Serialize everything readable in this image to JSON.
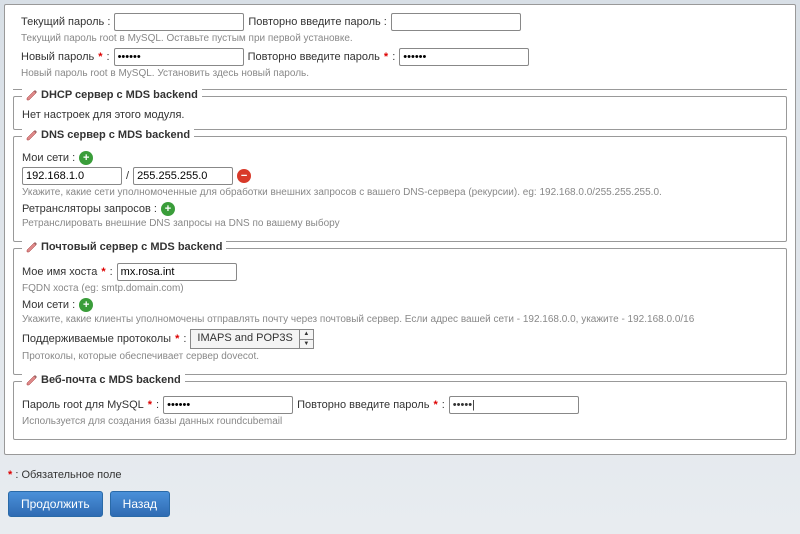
{
  "top": {
    "cur_pw_label": "Текущий пароль :",
    "cur_pw_value": "",
    "repeat_pw_label": "Повторно введите пароль :",
    "repeat_pw_value": "",
    "hint1": "Текущий пароль root в MySQL. Оставьте пустым при первой установке.",
    "new_pw_label": "Новый пароль",
    "new_pw_value": "••••••",
    "repeat2_label": "Повторно введите пароль",
    "repeat2_value": "••••••",
    "hint2": "Новый пароль root в MySQL. Установить здесь новый пароль.",
    "colon": " :"
  },
  "dhcp": {
    "title": "DHCP сервер с MDS backend",
    "empty": "Нет настроек для этого модуля."
  },
  "dns": {
    "title": "DNS сервер с MDS backend",
    "networks_label": "Мои сети :",
    "ip": "192.168.1.0",
    "slash": "/",
    "mask": "255.255.255.0",
    "hint1": "Укажите, какие сети уполномоченные для обработки внешних запросов с вашего DNS-сервера (рекурсии). eg: 192.168.0.0/255.255.255.0.",
    "relays_label": "Ретрансляторы запросов :",
    "hint2": "Ретранслировать внешние DNS запросы на DNS по вашему выбору"
  },
  "mail": {
    "title": "Почтовый сервер с MDS backend",
    "host_label": "Мое имя хоста",
    "host_value": "mx.rosa.int",
    "host_hint": "FQDN хоста (eg: smtp.domain.com)",
    "networks_label": "Мои сети :",
    "networks_hint": "Укажите, какие клиенты уполномочены отправлять почту через почтовый сервер. Если адрес вашей сети - 192.168.0.0, укажите - 192.168.0.0/16",
    "proto_label": "Поддерживаемые протоколы",
    "proto_value": "IMAPS and POP3S",
    "proto_hint": "Протоколы, которые обеспечивает сервер dovecot."
  },
  "webmail": {
    "title": "Веб-почта с MDS backend",
    "pw_label": "Пароль root для MySQL",
    "pw_value": "••••••",
    "repeat_label": "Повторно введите пароль",
    "repeat_value": "•••••",
    "hint": "Используется для создания базы данных roundcubemail"
  },
  "footer": {
    "required_note": ": Обязательное поле",
    "continue": "Продолжить",
    "back": "Назад"
  },
  "glyph": {
    "star": "*",
    "plus": "+",
    "minus": "−",
    "up": "▲",
    "down": "▼",
    "cursor": "|"
  }
}
